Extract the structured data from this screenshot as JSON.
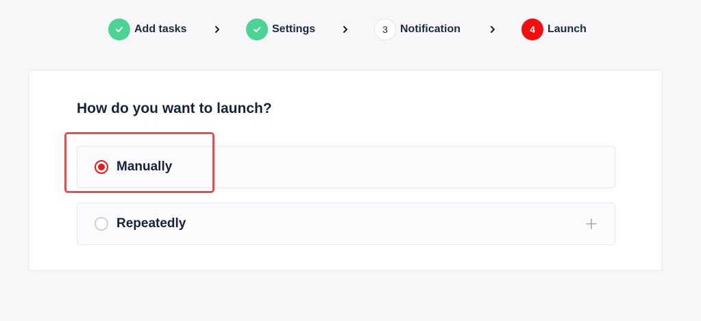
{
  "stepper": {
    "steps": [
      {
        "label": "Add tasks",
        "status": "done",
        "icon": "check-icon"
      },
      {
        "label": "Settings",
        "status": "done",
        "icon": "check-icon"
      },
      {
        "label": "Notification",
        "status": "pending",
        "number": "3"
      },
      {
        "label": "Launch",
        "status": "active",
        "number": "4"
      }
    ],
    "separator_icon": "chevron-right-icon"
  },
  "launch": {
    "title": "How do you want to launch?",
    "options": [
      {
        "label": "Manually",
        "selected": true
      },
      {
        "label": "Repeatedly",
        "selected": false,
        "icon": "plus-icon"
      }
    ]
  },
  "colors": {
    "done": "#4cd394",
    "active": "#f01010",
    "highlight": "#e05252",
    "text": "#14233a"
  }
}
